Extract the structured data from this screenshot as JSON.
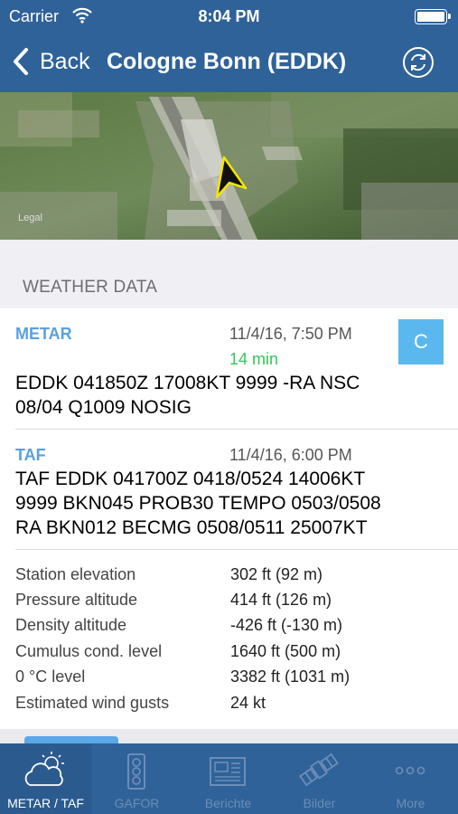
{
  "status": {
    "carrier": "Carrier",
    "time": "8:04 PM"
  },
  "nav": {
    "back": "Back",
    "title": "Cologne Bonn (EDDK)"
  },
  "map": {
    "legal": "Legal"
  },
  "section": {
    "title": "WEATHER DATA"
  },
  "metar": {
    "label": "METAR",
    "timestamp": "11/4/16, 7:50 PM",
    "age": "14 min",
    "age_color": "#34c759",
    "lines": [
      "EDDK 041850Z 17008KT 9999 -RA NSC",
      "08/04 Q1009 NOSIG"
    ],
    "button": "C"
  },
  "taf": {
    "label": "TAF",
    "timestamp": "11/4/16, 6:00 PM",
    "lines": [
      "TAF EDDK 041700Z 0418/0524 14006KT",
      "9999 BKN045 PROB30 TEMPO 0503/0508",
      "RA BKN012 BECMG 0508/0511 25007KT"
    ]
  },
  "info": [
    {
      "key": "Station elevation",
      "value": "302 ft (92 m)"
    },
    {
      "key": "Pressure altitude",
      "value": "414 ft (126 m)"
    },
    {
      "key": "Density altitude",
      "value": "-426 ft (-130 m)"
    },
    {
      "key": "Cumulus cond. level",
      "value": "1640 ft (500 m)"
    },
    {
      "key": "0 °C level",
      "value": "3382 ft (1031 m)"
    },
    {
      "key": "Estimated wind gusts",
      "value": "24 kt"
    }
  ],
  "tabs": [
    {
      "label": "METAR / TAF",
      "icon": "cloud-sun-icon",
      "active": true
    },
    {
      "label": "GAFOR",
      "icon": "traffic-light-icon",
      "active": false
    },
    {
      "label": "Berichte",
      "icon": "newspaper-icon",
      "active": false
    },
    {
      "label": "Bilder",
      "icon": "satellite-icon",
      "active": false
    },
    {
      "label": "More",
      "icon": "more-dots-icon",
      "active": false
    }
  ],
  "colors": {
    "accent": "#2f6299",
    "label_blue": "#5aa0e0",
    "c_button": "#5bb8ee"
  }
}
